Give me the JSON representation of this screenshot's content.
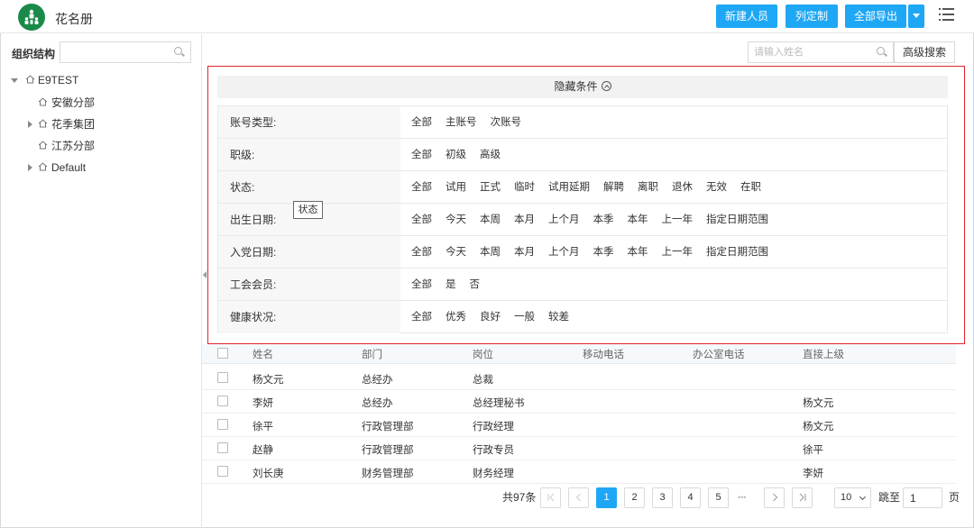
{
  "header": {
    "title": "花名册",
    "buttons": {
      "new_person": "新建人员",
      "customize_columns": "列定制",
      "export_all": "全部导出"
    },
    "accent_color": "#1ea7f5",
    "logo_color": "#1a8a4a"
  },
  "sidebar": {
    "title": "组织结构",
    "tree": [
      {
        "label": "E9TEST",
        "expanded": true
      },
      {
        "label": "安徽分部",
        "expanded": false
      },
      {
        "label": "花季集团",
        "expanded": false
      },
      {
        "label": "江苏分部",
        "expanded": false
      },
      {
        "label": "Default",
        "expanded": false
      }
    ]
  },
  "search": {
    "placeholder": "请输入姓名",
    "advanced_label": "高级搜索"
  },
  "filters": {
    "toggle_label": "隐藏条件",
    "highlight_color": "#e0242b",
    "rows": [
      {
        "label": "账号类型:",
        "options": [
          "全部",
          "主账号",
          "次账号"
        ]
      },
      {
        "label": "职级:",
        "options": [
          "全部",
          "初级",
          "高级"
        ]
      },
      {
        "label": "状态:",
        "options": [
          "全部",
          "试用",
          "正式",
          "临时",
          "试用延期",
          "解聘",
          "离职",
          "退休",
          "无效",
          "在职"
        ]
      },
      {
        "label": "出生日期:",
        "options": [
          "全部",
          "今天",
          "本周",
          "本月",
          "上个月",
          "本季",
          "本年",
          "上一年",
          "指定日期范围"
        ]
      },
      {
        "label": "入党日期:",
        "options": [
          "全部",
          "今天",
          "本周",
          "本月",
          "上个月",
          "本季",
          "本年",
          "上一年",
          "指定日期范围"
        ]
      },
      {
        "label": "工会会员:",
        "options": [
          "全部",
          "是",
          "否"
        ]
      },
      {
        "label": "健康状况:",
        "options": [
          "全部",
          "优秀",
          "良好",
          "一般",
          "较差"
        ]
      }
    ],
    "tooltip": "状态"
  },
  "table": {
    "columns": [
      "姓名",
      "部门",
      "岗位",
      "移动电话",
      "办公室电话",
      "直接上级"
    ],
    "rows": [
      [
        "杨文元",
        "总经办",
        "总裁",
        "",
        "",
        ""
      ],
      [
        "李妍",
        "总经办",
        "总经理秘书",
        "",
        "",
        "杨文元"
      ],
      [
        "徐平",
        "行政管理部",
        "行政经理",
        "",
        "",
        "杨文元"
      ],
      [
        "赵静",
        "行政管理部",
        "行政专员",
        "",
        "",
        "徐平"
      ],
      [
        "刘长庚",
        "财务管理部",
        "财务经理",
        "",
        "",
        "李妍"
      ]
    ]
  },
  "pagination": {
    "total_label": "共97条",
    "pages": [
      "1",
      "2",
      "3",
      "4",
      "5"
    ],
    "ellipsis": "•••",
    "current": "1",
    "page_size": "10",
    "jump_label": "跳至",
    "jump_value": "1",
    "page_suffix": "页"
  }
}
